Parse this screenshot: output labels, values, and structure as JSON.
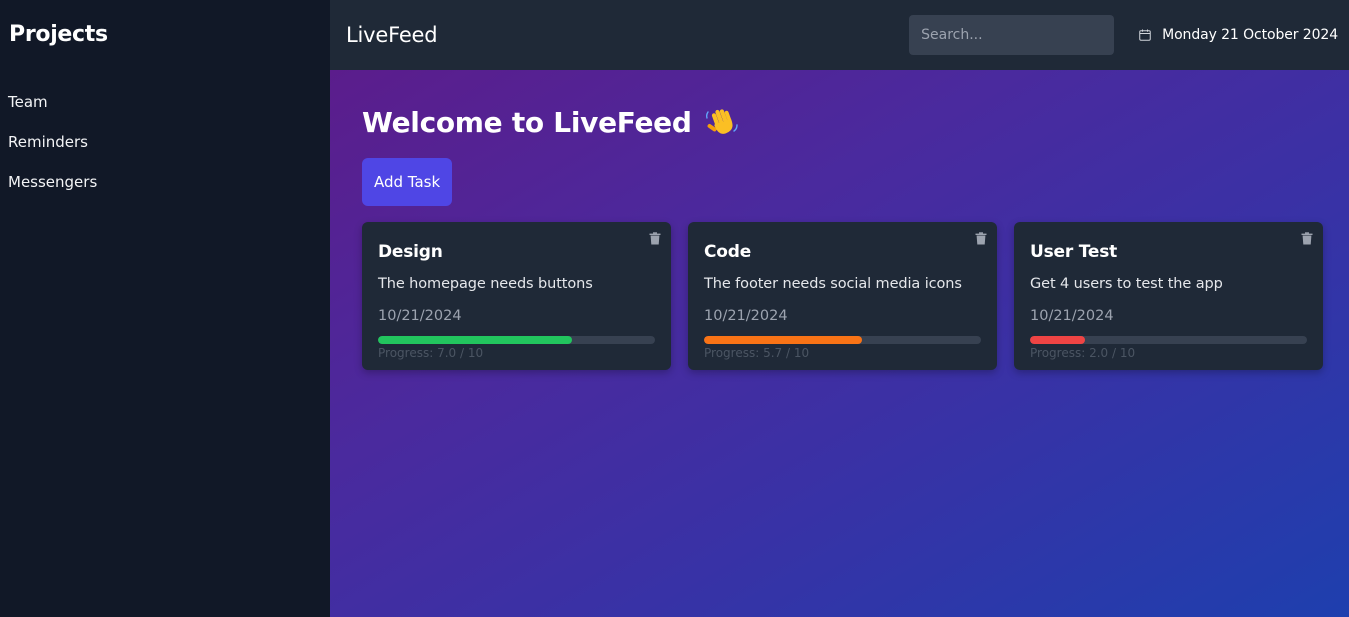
{
  "sidebar": {
    "title": "Projects",
    "items": [
      {
        "label": "Team"
      },
      {
        "label": "Reminders"
      },
      {
        "label": "Messengers"
      }
    ]
  },
  "header": {
    "brand": "LiveFeed",
    "search_placeholder": "Search...",
    "date": "Monday 21 October 2024",
    "calendar_icon": "calendar-icon"
  },
  "main": {
    "welcome": "Welcome to LiveFeed",
    "welcome_icon": "waving-hand-icon",
    "add_button": "Add Task"
  },
  "cards": [
    {
      "title": "Design",
      "description": "The homepage needs buttons",
      "date": "10/21/2024",
      "progress_label": "Progress: 7.0 / 10",
      "progress": 0.7,
      "color": "#22c55e"
    },
    {
      "title": "Code",
      "description": "The footer needs social media icons",
      "date": "10/21/2024",
      "progress_label": "Progress: 5.7 / 10",
      "progress": 0.57,
      "color": "#f97316"
    },
    {
      "title": "User Test",
      "description": "Get 4 users to test the app",
      "date": "10/21/2024",
      "progress_label": "Progress: 2.0 / 10",
      "progress": 0.2,
      "color": "#ef4444"
    }
  ]
}
